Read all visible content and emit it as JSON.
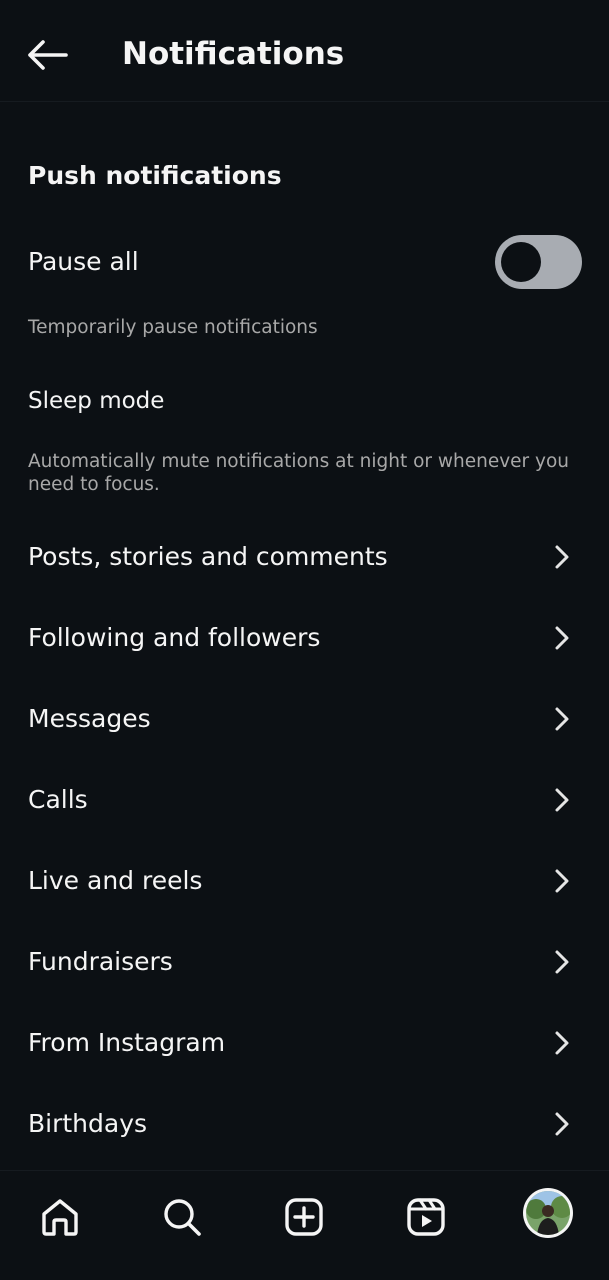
{
  "header": {
    "title": "Notifications",
    "back_icon": "arrow-left-icon"
  },
  "section": {
    "heading": "Push notifications"
  },
  "pause_all": {
    "label": "Pause all",
    "caption": "Temporarily pause notifications",
    "toggle_on": false
  },
  "sleep_mode": {
    "label": "Sleep mode",
    "caption": "Automatically mute notifications at night or whenever you need to focus."
  },
  "menu_items": [
    {
      "label": "Posts, stories and comments"
    },
    {
      "label": "Following and followers"
    },
    {
      "label": "Messages"
    },
    {
      "label": "Calls"
    },
    {
      "label": "Live and reels"
    },
    {
      "label": "Fundraisers"
    },
    {
      "label": "From Instagram"
    },
    {
      "label": "Birthdays"
    }
  ],
  "bottom_nav": {
    "icons": [
      "home-icon",
      "search-icon",
      "create-icon",
      "reels-icon",
      "profile-avatar"
    ]
  },
  "colors": {
    "background": "#0c1014",
    "text": "#f5f5f5",
    "secondary_text": "#a8a8a8",
    "toggle_track": "#a8acb2"
  }
}
